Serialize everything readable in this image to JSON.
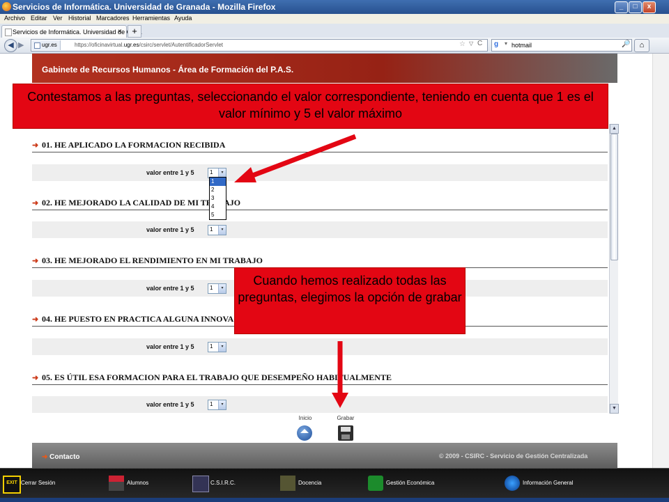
{
  "window": {
    "title": "Servicios de Informática. Universidad de Granada - Mozilla Firefox",
    "controls": [
      "_",
      "□",
      "x"
    ]
  },
  "menu": [
    "Archivo",
    "Editar",
    "Ver",
    "Historial",
    "Marcadores",
    "Herramientas",
    "Ayuda"
  ],
  "tab": {
    "label": "Servicios de Informática. Universidad de Gra...",
    "close": "×",
    "new_tab": "+"
  },
  "nav": {
    "back": "◀",
    "forward": "▶",
    "site": "ugr.es",
    "url_prefix": "https://oficinavirtual.",
    "url_domain": "ugr.es",
    "url_path": "/csirc/servlet/AutentificadorServlet",
    "star": "☆",
    "dropdown": "▽",
    "reload": "C",
    "search_engine": "g",
    "search_dropdown": "▾",
    "search_value": "hotmail",
    "search_icon": "🔎",
    "home": "⌂"
  },
  "header": {
    "title": "Gabinete de Recursos Humanos - Área de Formación del P.A.S."
  },
  "questions": [
    {
      "arrow": "➜",
      "title": "01. HE APLICADO LA FORMACION RECIBIDA",
      "value_label": "valor entre 1 y 5",
      "value": "1"
    },
    {
      "arrow": "➜",
      "title": "02. HE MEJORADO LA CALIDAD DE MI TRABAJO",
      "value_label": "valor entre 1 y 5",
      "value": "1"
    },
    {
      "arrow": "➜",
      "title": "03. HE MEJORADO EL RENDIMIENTO EN MI TRABAJO",
      "value_label": "valor entre 1 y 5",
      "value": "1"
    },
    {
      "arrow": "➜",
      "title": "04. HE PUESTO EN PRACTICA ALGUNA INNOVACION",
      "value_label": "valor entre 1 y 5",
      "value": "1"
    },
    {
      "arrow": "➜",
      "title": "05. ES ÚTIL ESA FORMACION PARA EL TRABAJO QUE DESEMPEÑO HABITUALMENTE",
      "value_label": "valor entre 1 y 5",
      "value": "1"
    }
  ],
  "select_button": "▾",
  "dropdown_options": [
    "1",
    "2",
    "3",
    "4",
    "5"
  ],
  "scroll": {
    "up": "▲",
    "down": "▼"
  },
  "buttons": {
    "inicio": "Inicio",
    "grabar": "Grabar"
  },
  "footer": {
    "contact": "Contacto",
    "copyright": "© 2009 - CSIRC - Servicio de Gestión Centralizada"
  },
  "taskbar": {
    "exit_badge": "EXIT",
    "items": [
      "Cerrar Sesión",
      "Alumnos",
      "C.S.I.R.C.",
      "Docencia",
      "Gestión Económica",
      "Información General"
    ]
  },
  "callouts": {
    "top": "Contestamos a las preguntas, seleccionando el valor correspondiente, teniendo en cuenta que 1 es el valor mínimo y  5 el valor máximo",
    "bottom": "Cuando hemos realizado todas las preguntas, elegimos la opción de grabar"
  },
  "colors": {
    "callout": "#e30613",
    "header": "#962215",
    "arrow": "#e30613"
  }
}
